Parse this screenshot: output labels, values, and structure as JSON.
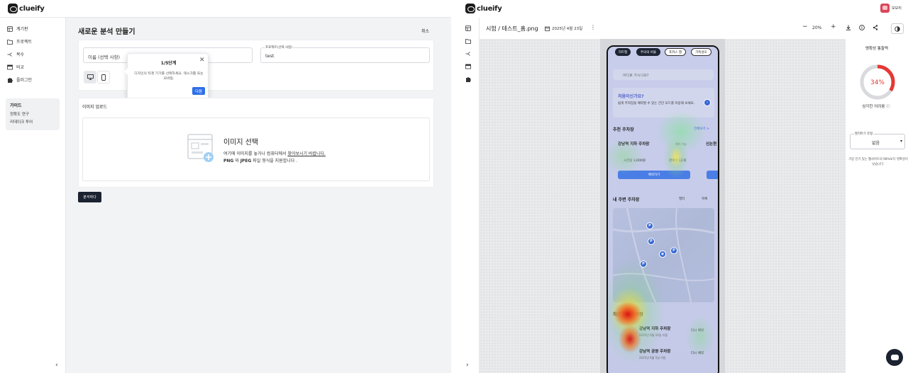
{
  "app": {
    "name": "clueify"
  },
  "left": {
    "nav": [
      {
        "label": "계기판",
        "icon": "dashboard-icon"
      },
      {
        "label": "프로젝트",
        "icon": "folder-icon"
      },
      {
        "label": "복수",
        "icon": "split-icon"
      },
      {
        "label": "비교",
        "icon": "compare-icon"
      },
      {
        "label": "플러그인",
        "icon": "puzzle-icon"
      }
    ],
    "guide": {
      "title": "가이드",
      "items": [
        "정확도 연구",
        "리데이크 투어"
      ]
    },
    "page_title": "새로운 분석 만들기",
    "cancel_label": "취소",
    "name_field": {
      "placeholder": "이름 (선택 사항)"
    },
    "project_field": {
      "label": "프로젝트(선택 사항)",
      "value": "test"
    },
    "popover": {
      "step": "1/5단계",
      "body": "디자인의 타겟 기기를 선택하세요. 데스크톱 또는 모바일.",
      "next_label": "다음"
    },
    "upload": {
      "section_title": "이미지 업로드",
      "title": "이미지 선택",
      "line1_prefix": "여기에 이미지를 놓거나 컴퓨터에서 ",
      "line1_link": "찾아보시기 바랍니다.",
      "line2_png": "PNG",
      "line2_mid": " 와 ",
      "line2_jpeg": "JPEG",
      "line2_suffix": " 파일 형식을 지원합니다 ."
    },
    "analyze_label": "분석하다"
  },
  "right": {
    "user_name": "보보리",
    "crumb": "시험  /  테스트_홈.png",
    "date": "2025년 4월 23일",
    "zoom": "20%",
    "phone": {
      "chips": [
        "히트맵",
        "주의의 비율",
        "포커스 맵",
        "가독성오"
      ],
      "search_placeholder": "어디로 가시나요?",
      "promo_title": "처음이신가요?",
      "promo_body": "쉽게 주차장을 예약할 수 있는 간단 모드를 이용해 보세요.",
      "rec_title": "추천 주차장",
      "see_all": "전체보기 >",
      "lot1_name": "강남역 지하 주차장",
      "lot1_price": "시간당 3,000원",
      "lot1_avail": "잔여석 12개",
      "lot1_tag": "예약 가능",
      "lot2_name": "신논현",
      "reserve_label": "예약하기",
      "nearby_title": "내 주변 주차장",
      "filter_label": "필터",
      "list_label": "목록",
      "recent_title": "최근 이용 주차장",
      "recent1_name": "강남역 지하 주차장",
      "recent1_date": "2025년 6월 10일 이용",
      "recent2_name": "강남역 공영 주차장",
      "recent2_date": "2025년 6월 5일 이용",
      "rebook_label": "다시 예약"
    },
    "panel": {
      "title": "명확성 통찰력",
      "score": "34%",
      "score_value": 0.34,
      "difficulty": "심각한 어려움",
      "select_label": "벤치마크 유형",
      "select_value": "없음",
      "note": "가장 인기 있는 웹사이트의 98%보다 명확성이 낮습니다."
    }
  },
  "colors": {
    "accent": "#2f6fe6",
    "dark_button": "#1b2230",
    "gauge_red": "#e53935",
    "gauge_track": "#d8dadd"
  }
}
